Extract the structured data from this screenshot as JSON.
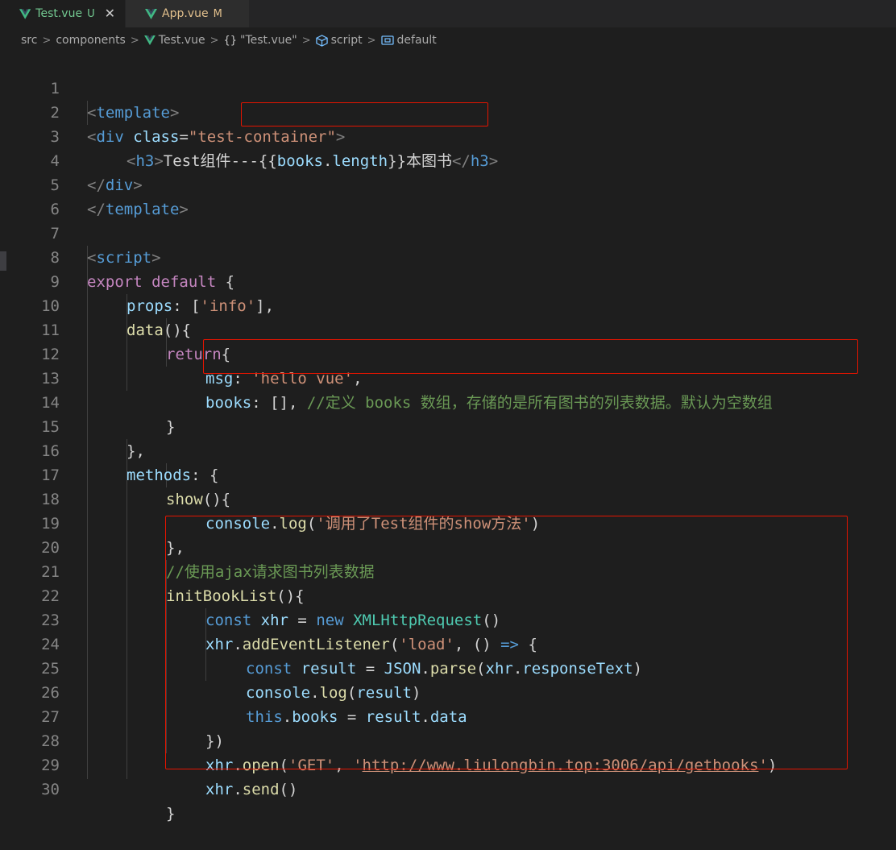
{
  "tabs": [
    {
      "name": "Test.vue",
      "status": "U",
      "active": true
    },
    {
      "name": "App.vue",
      "status": "M",
      "active": false
    }
  ],
  "tab_close_glyph": "✕",
  "breadcrumb": {
    "items": [
      "src",
      "components",
      "Test.vue",
      "\"Test.vue\"",
      "script",
      "default"
    ],
    "brace_glyph": "{}"
  },
  "editor": {
    "lines": [
      {
        "n": "1"
      },
      {
        "n": "2"
      },
      {
        "n": "3"
      },
      {
        "n": "4"
      },
      {
        "n": "5"
      },
      {
        "n": "6"
      },
      {
        "n": "7"
      },
      {
        "n": "8"
      },
      {
        "n": "9"
      },
      {
        "n": "10"
      },
      {
        "n": "11"
      },
      {
        "n": "12"
      },
      {
        "n": "13"
      },
      {
        "n": "14"
      },
      {
        "n": "15"
      },
      {
        "n": "16"
      },
      {
        "n": "17"
      },
      {
        "n": "18"
      },
      {
        "n": "19"
      },
      {
        "n": "20"
      },
      {
        "n": "21"
      },
      {
        "n": "22"
      },
      {
        "n": "23"
      },
      {
        "n": "24"
      },
      {
        "n": "25"
      },
      {
        "n": "26"
      },
      {
        "n": "27"
      },
      {
        "n": "28"
      },
      {
        "n": "29"
      },
      {
        "n": "30"
      }
    ],
    "code": {
      "l1": {
        "open": "<",
        "tag": "template",
        "close": ">"
      },
      "l2": {
        "open": "<",
        "tag": "div",
        "attr": "class",
        "eq": "=",
        "val": "\"test-container\"",
        "close": ">"
      },
      "l3": {
        "open": "<",
        "tag": "h3",
        "close": ">",
        "text1": "Test组件",
        "text2": "---{{",
        "expr_obj": "books",
        "dot": ".",
        "expr_prop": "length",
        "text3": "}}本图书",
        "end_open": "</",
        "end_tag": "h3",
        "end_close": ">"
      },
      "l4": {
        "open": "</",
        "tag": "div",
        "close": ">"
      },
      "l5": {
        "open": "</",
        "tag": "template",
        "close": ">"
      },
      "l7": {
        "open": "<",
        "tag": "script",
        "close": ">"
      },
      "l8": {
        "kw1": "export",
        "kw2": "default",
        "brace": "{"
      },
      "l9": {
        "prop": "props",
        "rest1": ": [",
        "str": "'info'",
        "rest2": "],"
      },
      "l10": {
        "fn": "data",
        "rest": "(){"
      },
      "l11": {
        "kw": "return",
        "rest": "{"
      },
      "l12": {
        "prop": "msg",
        "rest1": ": ",
        "str": "'hello vue'",
        "rest2": ","
      },
      "l13": {
        "prop": "books",
        "rest1": ": [], ",
        "cmt": "//定义 books 数组，存储的是所有图书的列表数据。默认为空数组"
      },
      "l14": {
        "rest": "}"
      },
      "l15": {
        "rest": "},"
      },
      "l16": {
        "prop": "methods",
        "rest": ": {"
      },
      "l17": {
        "fn": "show",
        "rest": "(){"
      },
      "l18": {
        "obj": "console",
        "dot": ".",
        "fn": "log",
        "p1": "(",
        "str": "'调用了Test组件的show方法'",
        "p2": ")"
      },
      "l19": {
        "rest": "},"
      },
      "l20": {
        "cmt": "//使用ajax请求图书列表数据"
      },
      "l21": {
        "fn": "initBookList",
        "rest": "(){"
      },
      "l22": {
        "kw": "const",
        "var": "xhr",
        "eq": " = ",
        "kw2": "new",
        "cls": "XMLHttpRequest",
        "rest": "()"
      },
      "l23": {
        "obj": "xhr",
        "dot": ".",
        "fn": "addEventListener",
        "p1": "(",
        "str": "'load'",
        "rest": ", () ",
        "arrow": "=>",
        "rest2": " {"
      },
      "l24": {
        "kw": "const",
        "var": "result",
        "eq": " = ",
        "cls": "JSON",
        "dot": ".",
        "fn": "parse",
        "p1": "(",
        "obj": "xhr",
        "dot2": ".",
        "prop": "responseText",
        "p2": ")"
      },
      "l25": {
        "obj": "console",
        "dot": ".",
        "fn": "log",
        "p1": "(",
        "var": "result",
        "p2": ")"
      },
      "l26": {
        "kw": "this",
        "dot": ".",
        "prop": "books",
        "eq": " = ",
        "obj": "result",
        "dot2": ".",
        "prop2": "data"
      },
      "l27": {
        "rest": "})"
      },
      "l28": {
        "obj": "xhr",
        "dot": ".",
        "fn": "open",
        "p1": "(",
        "str1": "'GET'",
        "comma": ", ",
        "q1": "'",
        "url": "http://www.liulongbin.top:3006/api/getbooks",
        "q2": "'",
        "p2": ")"
      },
      "l29": {
        "obj": "xhr",
        "dot": ".",
        "fn": "send",
        "rest": "()"
      },
      "l30": {
        "rest": "}"
      }
    }
  },
  "colors": {
    "background": "#1e1e1e",
    "highlight_box": "#e51400",
    "vue_green": "#41b883",
    "untracked": "#73c991",
    "modified": "#e2c08d"
  }
}
